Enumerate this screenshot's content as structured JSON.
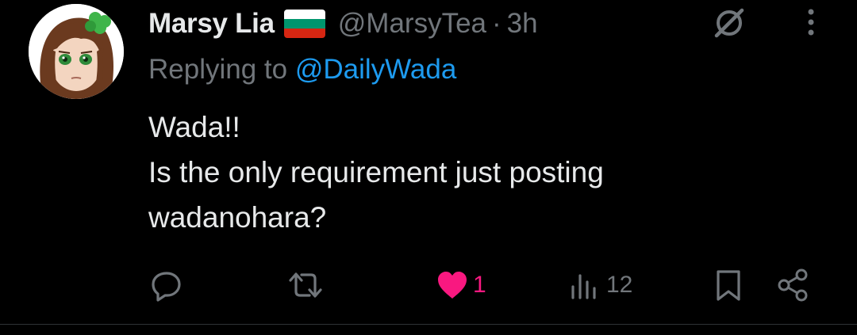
{
  "tweet": {
    "display_name": "Marsy Lia",
    "flag_icon": "bulgaria-flag-icon",
    "flag_colors": [
      "#ffffff",
      "#00966e",
      "#d62612"
    ],
    "handle": "@MarsyTea",
    "separator": "·",
    "time": "3h",
    "replying_prefix": "Replying to ",
    "replying_to": "@DailyWada",
    "text_lines": [
      "Wada!!",
      "Is the only requirement just posting",
      "wadanohara?"
    ]
  },
  "actions": {
    "reply_icon": "reply-icon",
    "retweet_icon": "retweet-icon",
    "like_icon": "heart-filled-icon",
    "like_count": "1",
    "views_icon": "views-icon",
    "views_count": "12",
    "bookmark_icon": "bookmark-icon",
    "share_icon": "share-icon"
  },
  "colors": {
    "background": "#000000",
    "text_primary": "#e7e9ea",
    "text_secondary": "#71767b",
    "link": "#1d9bf0",
    "like": "#f91880",
    "divider": "#2f3336"
  }
}
